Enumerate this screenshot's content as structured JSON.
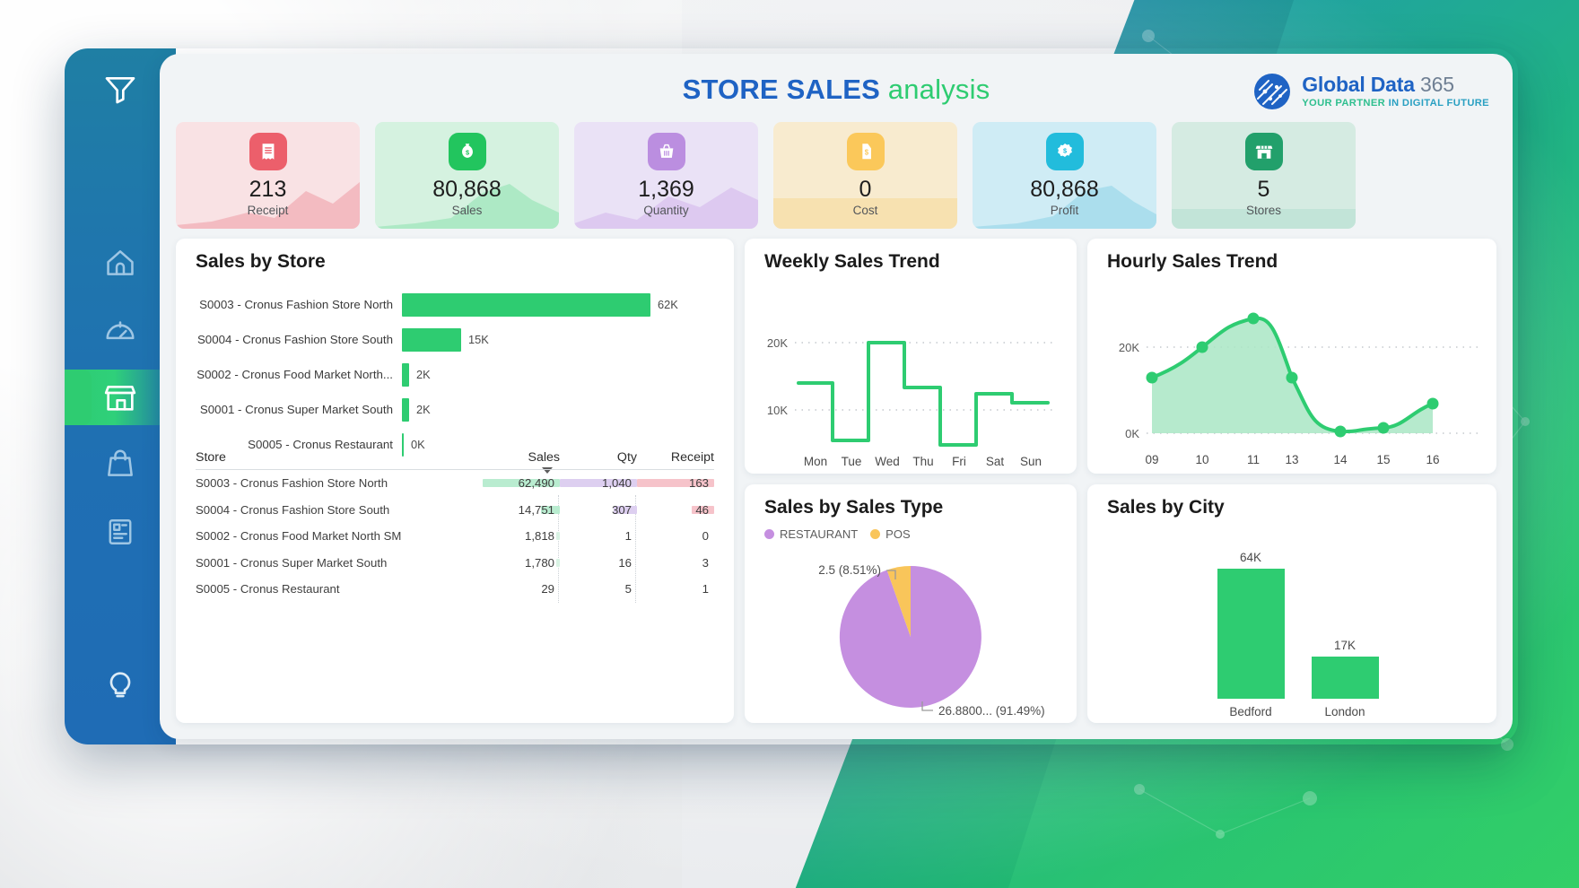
{
  "header": {
    "title_strong": "STORE SALES",
    "title_light": " analysis",
    "logo_line1": "Global Data ",
    "logo_line1_gray": "365",
    "logo_line2_a": "YOUR PARTNER ",
    "logo_line2_b": "IN DIGITAL FUTURE"
  },
  "sidebar": {
    "items": [
      {
        "icon": "filter-icon",
        "name": "sidebar-item-filter"
      },
      {
        "icon": "home-icon",
        "name": "sidebar-item-home"
      },
      {
        "icon": "gauge-icon",
        "name": "sidebar-item-dashboard"
      },
      {
        "icon": "store-icon",
        "name": "sidebar-item-store",
        "active": true
      },
      {
        "icon": "shopping-bag-icon",
        "name": "sidebar-item-sales"
      },
      {
        "icon": "report-icon",
        "name": "sidebar-item-report"
      },
      {
        "icon": "lightbulb-icon",
        "name": "sidebar-item-insights"
      }
    ]
  },
  "kpis": [
    {
      "value": "213",
      "label": "Receipt",
      "icon": "receipt-icon",
      "bg": "#f9e2e4",
      "icon_bg": "#ec5f6b",
      "spark": "#f2b4bb"
    },
    {
      "value": "80,868",
      "label": "Sales",
      "icon": "money-bag-icon",
      "bg": "#d5f2e0",
      "icon_bg": "#22c55e",
      "spark": "#a8e8c2"
    },
    {
      "value": "1,369",
      "label": "Quantity",
      "icon": "basket-icon",
      "bg": "#eae2f6",
      "icon_bg": "#bb8ee0",
      "spark": "#dcc6ef"
    },
    {
      "value": "0",
      "label": "Cost",
      "icon": "price-tag-icon",
      "bg": "#f8ebcf",
      "icon_bg": "#fbc košt",
      "spark": "#f7dda6"
    },
    {
      "value": "80,868",
      "label": "Profit",
      "icon": "badge-dollar-icon",
      "bg": "#cfecf5",
      "icon_bg": "#22bcdc",
      "spark": "#a6ddec"
    },
    {
      "value": "5",
      "label": "Stores",
      "icon": "storefront-icon",
      "bg": "#d5ebe2",
      "icon_bg": "#22a06b",
      "spark": "#b3ded0"
    }
  ],
  "sales_by_store": {
    "title": "Sales by Store",
    "chart_data": {
      "type": "bar",
      "orientation": "horizontal",
      "title": "Sales by Store",
      "categories": [
        "S0003 - Cronus Fashion Store North",
        "S0004 - Cronus Fashion Store South",
        "S0002 - Cronus Food Market North...",
        "S0001 - Cronus Super Market South",
        "S0005 - Cronus Restaurant"
      ],
      "values": [
        62490,
        14751,
        1818,
        1780,
        29
      ],
      "value_labels": [
        "62K",
        "15K",
        "2K",
        "2K",
        "0K"
      ],
      "xlim": [
        0,
        62490
      ],
      "color": "#2ecc71",
      "grid": false
    }
  },
  "store_table": {
    "columns": [
      "Store",
      "Sales",
      "Qty",
      "Receipt"
    ],
    "sorted_by": "Sales",
    "rows": [
      {
        "store": "S0003 - Cronus Fashion Store North",
        "sales": "62,490",
        "qty": "1,040",
        "receipt": "163"
      },
      {
        "store": "S0004 - Cronus Fashion Store South",
        "sales": "14,751",
        "qty": "307",
        "receipt": "46"
      },
      {
        "store": "S0002 - Cronus Food Market North SM",
        "sales": "1,818",
        "qty": "1",
        "receipt": "0"
      },
      {
        "store": "S0001 - Cronus Super Market South",
        "sales": "1,780",
        "qty": "16",
        "receipt": "3"
      },
      {
        "store": "S0005 - Cronus Restaurant",
        "sales": "29",
        "qty": "5",
        "receipt": "1"
      }
    ]
  },
  "weekly": {
    "title": "Weekly Sales Trend",
    "chart_data": {
      "type": "line",
      "subtype": "step",
      "title": "Weekly Sales Trend",
      "categories": [
        "Mon",
        "Tue",
        "Wed",
        "Thu",
        "Fri",
        "Sat",
        "Sun"
      ],
      "values": [
        14000,
        5500,
        20000,
        13500,
        5000,
        12500,
        11000
      ],
      "ytick_labels": [
        "10K",
        "20K"
      ],
      "yticks": [
        10000,
        20000
      ],
      "ylim": [
        4000,
        21500
      ],
      "color": "#2ecc71",
      "grid": true
    }
  },
  "hourly": {
    "title": "Hourly Sales Trend",
    "chart_data": {
      "type": "area",
      "title": "Hourly Sales Trend",
      "categories": [
        "09",
        "10",
        "11",
        "13",
        "14",
        "15",
        "16"
      ],
      "values": [
        13000,
        20000,
        23500,
        13000,
        700,
        2000,
        8000
      ],
      "ytick_labels": [
        "0K",
        "20K"
      ],
      "yticks": [
        0,
        20000
      ],
      "ylim": [
        0,
        26000
      ],
      "color": "#2ecc71",
      "fill": "#a9e6c4",
      "grid": true
    }
  },
  "sales_type": {
    "title": "Sales by Sales Type",
    "chart_data": {
      "type": "pie",
      "title": "Sales by Sales Type",
      "labels": [
        "RESTAURANT",
        "POS"
      ],
      "values": [
        91.49,
        8.51
      ],
      "colors": [
        "#c58fe0",
        "#f9c55a"
      ],
      "callouts": [
        "26.8800... (91.49%)",
        "2.5 (8.51%)"
      ],
      "legend_position": "top-left"
    }
  },
  "city": {
    "title": "Sales by City",
    "chart_data": {
      "type": "bar",
      "title": "Sales by City",
      "categories": [
        "Bedford",
        "London"
      ],
      "values": [
        64000,
        17000
      ],
      "value_labels": [
        "64K",
        "17K"
      ],
      "ylim": [
        0,
        70000
      ],
      "color": "#2ecc71",
      "grid": false
    }
  }
}
